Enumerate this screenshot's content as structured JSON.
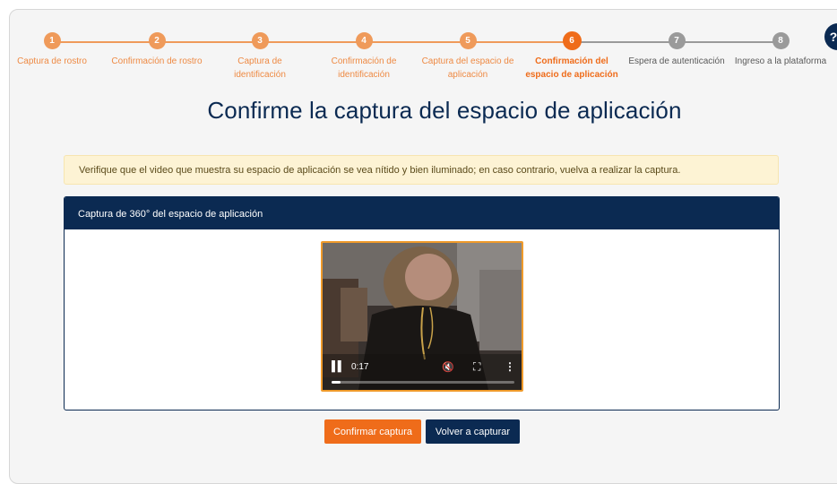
{
  "steps": [
    {
      "number": "1",
      "label": "Captura de rostro",
      "state": "done"
    },
    {
      "number": "2",
      "label": "Confirmación de rostro",
      "state": "done"
    },
    {
      "number": "3",
      "label": "Captura de identificación",
      "state": "done"
    },
    {
      "number": "4",
      "label": "Confirmación de identificación",
      "state": "done"
    },
    {
      "number": "5",
      "label": "Captura del espacio de aplicación",
      "state": "done"
    },
    {
      "number": "6",
      "label": "Confirmación del espacio de aplicación",
      "state": "active"
    },
    {
      "number": "7",
      "label": "Espera de autenticación",
      "state": "todo"
    },
    {
      "number": "8",
      "label": "Ingreso a la plataforma",
      "state": "todo"
    }
  ],
  "colors": {
    "accent": "#ef6c1a",
    "done": "#ef9a5a",
    "pending": "#9a9a9a",
    "navy": "#0b2a52",
    "alert_bg": "#fdf3d4"
  },
  "page": {
    "title": "Confirme la captura del espacio de aplicación"
  },
  "alert": {
    "text": "Verifique que el video que muestra su espacio de aplicación se vea nítido y bien iluminado; en caso contrario, vuelva a realizar la captura."
  },
  "card": {
    "header": "Captura de 360° del espacio de aplicación"
  },
  "video": {
    "time": "0:17",
    "play_icon": "pause-icon",
    "mute_icon": "muted-speaker-icon",
    "fullscreen_icon": "fullscreen-icon",
    "more_icon": "more-options-icon",
    "progress": 0.05
  },
  "buttons": {
    "confirm": "Confirmar captura",
    "retake": "Volver a capturar"
  }
}
